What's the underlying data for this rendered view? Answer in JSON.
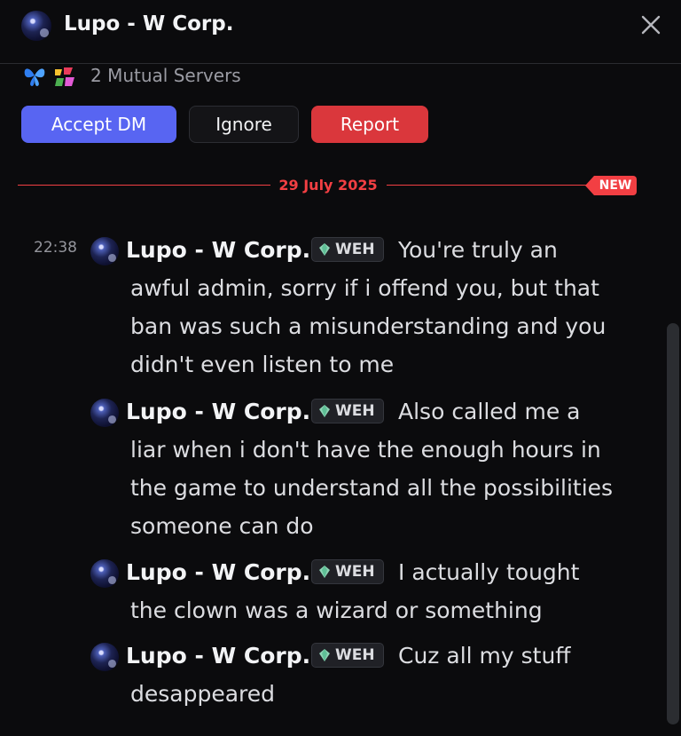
{
  "header": {
    "title": "Lupo - W Corp.",
    "close_icon": "close-x-icon"
  },
  "mutual": {
    "server_icons": [
      "butterfly-server-icon",
      "colorful-server-icon"
    ],
    "text": "2 Mutual Servers"
  },
  "actions": {
    "accept": "Accept DM",
    "ignore": "Ignore",
    "report": "Report"
  },
  "divider": {
    "date": "29 July 2025",
    "badge": "NEW"
  },
  "messages": [
    {
      "timestamp": "22:38",
      "username": "Lupo - W Corp.",
      "tag": "WEH",
      "text": "You're truly an awful admin, sorry if i offend you, but that ban was such a misunderstanding and you didn't even listen to me"
    },
    {
      "timestamp": "",
      "username": "Lupo - W Corp.",
      "tag": "WEH",
      "text": "Also called me a liar when i don't have the enough hours in the game to understand all the possibilities someone can do"
    },
    {
      "timestamp": "",
      "username": "Lupo - W Corp.",
      "tag": "WEH",
      "text": "I actually tought the clown was a wizard or something"
    },
    {
      "timestamp": "",
      "username": "Lupo - W Corp.",
      "tag": "WEH",
      "text": "Cuz all my stuff desappeared"
    }
  ],
  "colors": {
    "background": "#0b0b0d",
    "accent": "#5865f2",
    "danger": "#da373c",
    "new_line": "#f23f43"
  }
}
